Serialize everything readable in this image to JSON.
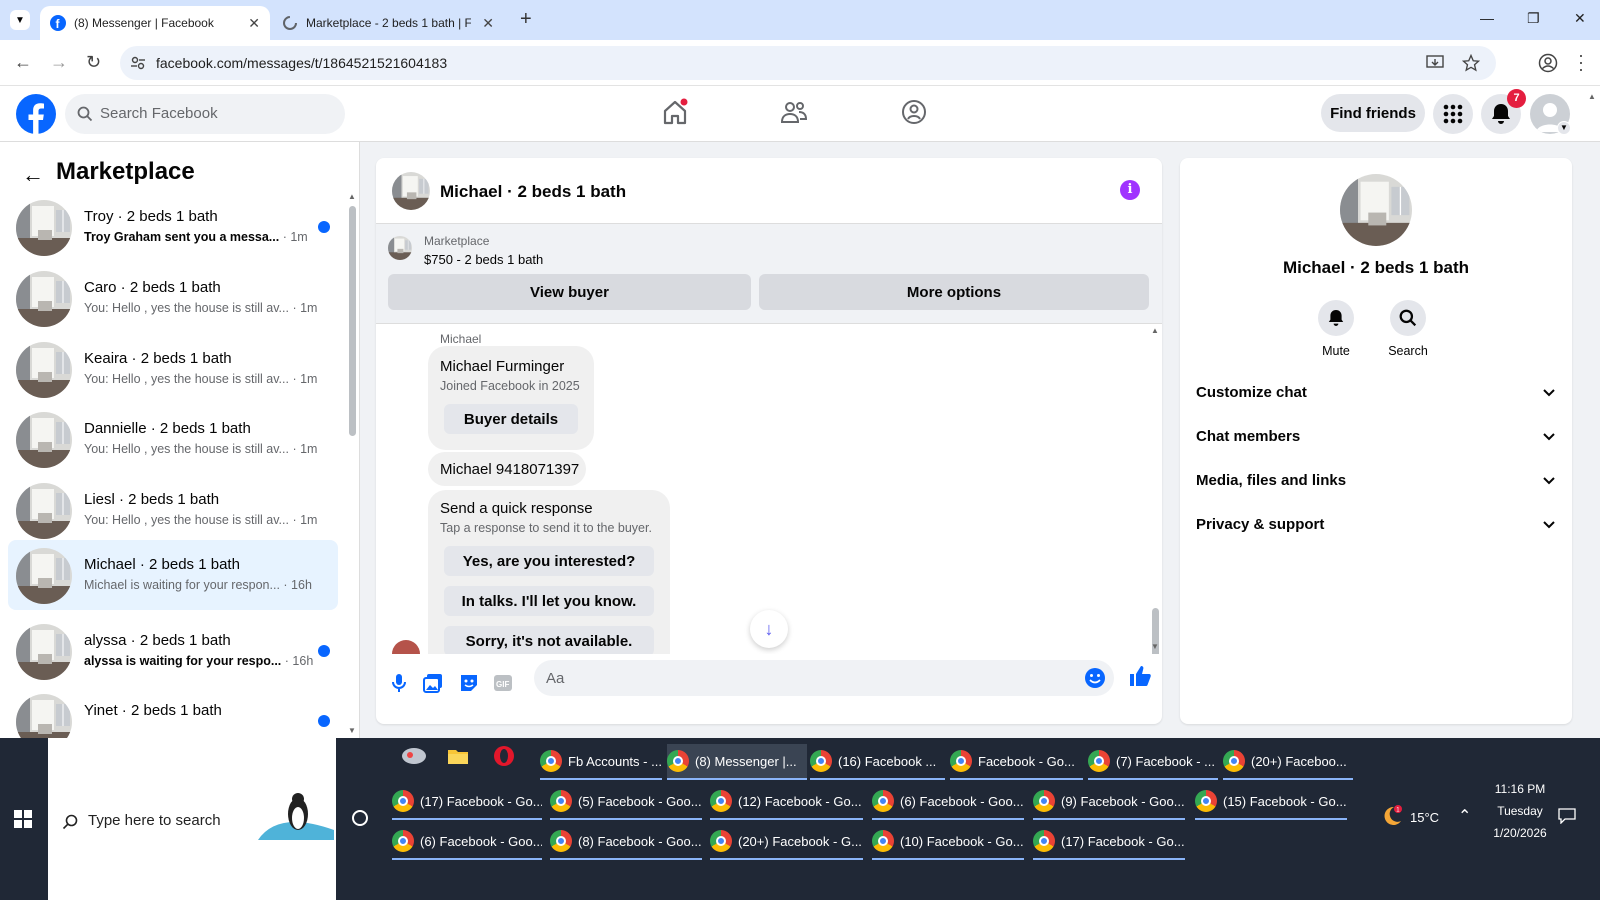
{
  "browser": {
    "tabs": [
      {
        "title": "(8) Messenger | Facebook",
        "active": true
      },
      {
        "title": "Marketplace - 2 beds 1 bath | F",
        "active": false
      }
    ],
    "url": "facebook.com/messages/t/1864521521604183"
  },
  "fb_header": {
    "search_placeholder": "Search Facebook",
    "find_friends": "Find friends",
    "notification_count": "7"
  },
  "left": {
    "title": "Marketplace",
    "conversations": [
      {
        "name": "Troy · 2 beds 1 bath",
        "preview": "Troy Graham sent you a messa...",
        "time": "· 1m",
        "unread": true
      },
      {
        "name": "Caro · 2 beds 1 bath",
        "preview": "You: Hello , yes the house is still av...",
        "time": "· 1m",
        "unread": false
      },
      {
        "name": "Keaira · 2 beds 1 bath",
        "preview": "You: Hello , yes the house is still av...",
        "time": "· 1m",
        "unread": false
      },
      {
        "name": "Dannielle · 2 beds 1 bath",
        "preview": "You: Hello , yes the house is still av...",
        "time": "· 1m",
        "unread": false
      },
      {
        "name": "Liesl · 2 beds 1 bath",
        "preview": "You: Hello , yes the house is still av...",
        "time": "· 1m",
        "unread": false
      },
      {
        "name": "Michael · 2 beds 1 bath",
        "preview": "Michael is waiting for your respon...",
        "time": "· 16h",
        "unread": false,
        "selected": true
      },
      {
        "name": "alyssa · 2 beds 1 bath",
        "preview": "alyssa is waiting for your respo...",
        "time": "· 16h",
        "unread": true
      },
      {
        "name": "Yinet · 2 beds 1 bath",
        "preview": "",
        "time": "",
        "unread": true
      }
    ]
  },
  "chat": {
    "title": "Michael · 2 beds 1 bath",
    "banner": {
      "label": "Marketplace",
      "listing": "$750 - 2 beds 1 bath",
      "view_buyer": "View buyer",
      "more_options": "More options"
    },
    "sender": "Michael",
    "buyer_card": {
      "name": "Michael Furminger",
      "joined": "Joined Facebook in 2025",
      "button": "Buyer details"
    },
    "phone_msg": "Michael 9418071397",
    "quick": {
      "title": "Send a quick response",
      "subtitle": "Tap a response to send it to the buyer.",
      "options": [
        "Yes, are you interested?",
        "In talks. I'll let you know.",
        "Sorry, it's not available."
      ]
    },
    "input_placeholder": "Aa"
  },
  "right": {
    "name": "Michael · 2 beds 1 bath",
    "mute": "Mute",
    "search": "Search",
    "sections": [
      "Customize chat",
      "Chat members",
      "Media, files and links",
      "Privacy & support"
    ]
  },
  "taskbar": {
    "search_placeholder": "Type here to search",
    "row1": [
      "Fb Accounts - ...",
      "(8) Messenger |...",
      "(16) Facebook ...",
      "Facebook - Go...",
      "(7) Facebook - ...",
      "(20+) Faceboo..."
    ],
    "row2": [
      "(17) Facebook - Go...",
      "(5) Facebook - Goo...",
      "(12) Facebook - Go...",
      "(6) Facebook - Goo...",
      "(9) Facebook - Goo...",
      "(15) Facebook - Go..."
    ],
    "row3": [
      "(6) Facebook - Goo...",
      "(8) Facebook - Goo...",
      "(20+) Facebook - G...",
      "(10) Facebook - Go...",
      "(17) Facebook - Go..."
    ],
    "temp": "15°C",
    "time": "11:16 PM",
    "day": "Tuesday",
    "date": "1/20/2026"
  },
  "colors": {
    "fb_blue": "#0866ff",
    "info_purple": "#a033ff",
    "taskbar": "#202836"
  }
}
